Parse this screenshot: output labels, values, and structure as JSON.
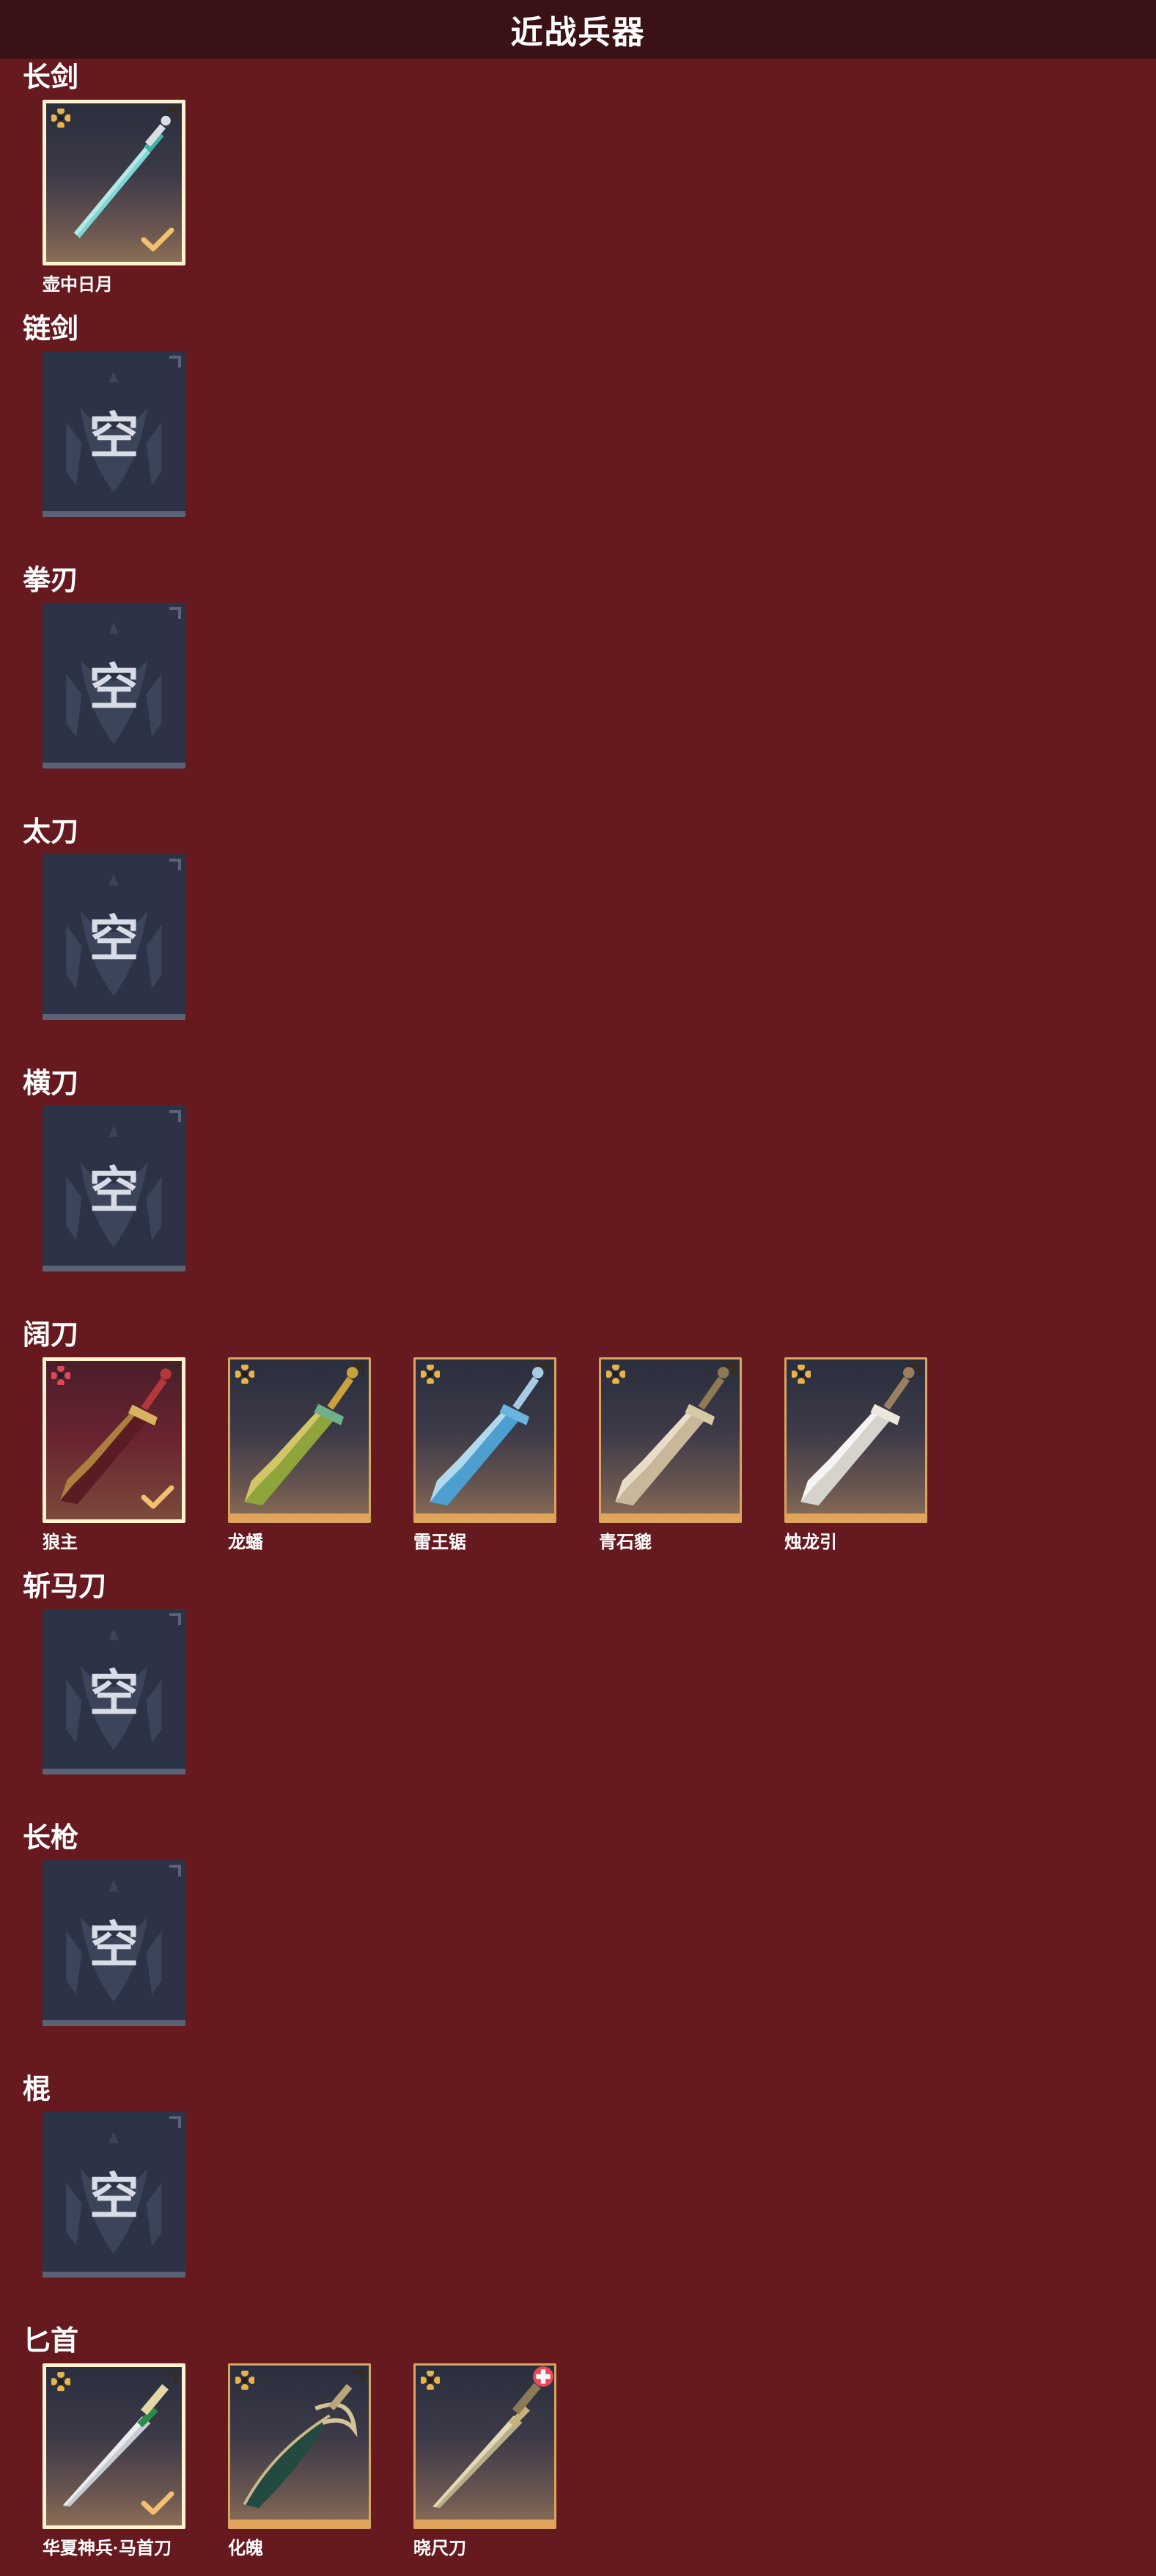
{
  "header": {
    "title": "近战兵器"
  },
  "empty_label": "空",
  "colors": {
    "background": "#661a1f",
    "header": "#3a1114",
    "tile_gold_border": "#d9a45e",
    "tile_selected_border": "#fff3d0",
    "empty_tile": "#2c3346"
  },
  "sections": [
    {
      "title": "长剑",
      "items": [
        {
          "name": "壶中日月",
          "selected": true,
          "rarity": "gold",
          "art": "longsword-teal"
        }
      ]
    },
    {
      "title": "链剑",
      "items": []
    },
    {
      "title": "拳刃",
      "items": []
    },
    {
      "title": "太刀",
      "items": []
    },
    {
      "title": "横刀",
      "items": []
    },
    {
      "title": "阔刀",
      "items": [
        {
          "name": "狼主",
          "selected": true,
          "rarity": "red",
          "art": "broadblade-red"
        },
        {
          "name": "龙蟠",
          "selected": false,
          "rarity": "gold",
          "art": "broadblade-gold"
        },
        {
          "name": "雷王锯",
          "selected": false,
          "rarity": "gold",
          "art": "broadblade-ice"
        },
        {
          "name": "青石貔",
          "selected": false,
          "rarity": "gold",
          "art": "broadblade-ivory"
        },
        {
          "name": "烛龙引",
          "selected": false,
          "rarity": "gold",
          "art": "broadblade-white"
        }
      ]
    },
    {
      "title": "斩马刀",
      "items": []
    },
    {
      "title": "长枪",
      "items": []
    },
    {
      "title": "棍",
      "items": []
    },
    {
      "title": "匕首",
      "items": [
        {
          "name": "华夏神兵·马首刀",
          "selected": true,
          "rarity": "gold",
          "art": "dagger-ivory"
        },
        {
          "name": "化魄",
          "selected": false,
          "rarity": "gold",
          "art": "dagger-green"
        },
        {
          "name": "晓尺刀",
          "selected": false,
          "rarity": "gold",
          "art": "dagger-gold",
          "badge": "red-cross"
        }
      ]
    }
  ]
}
